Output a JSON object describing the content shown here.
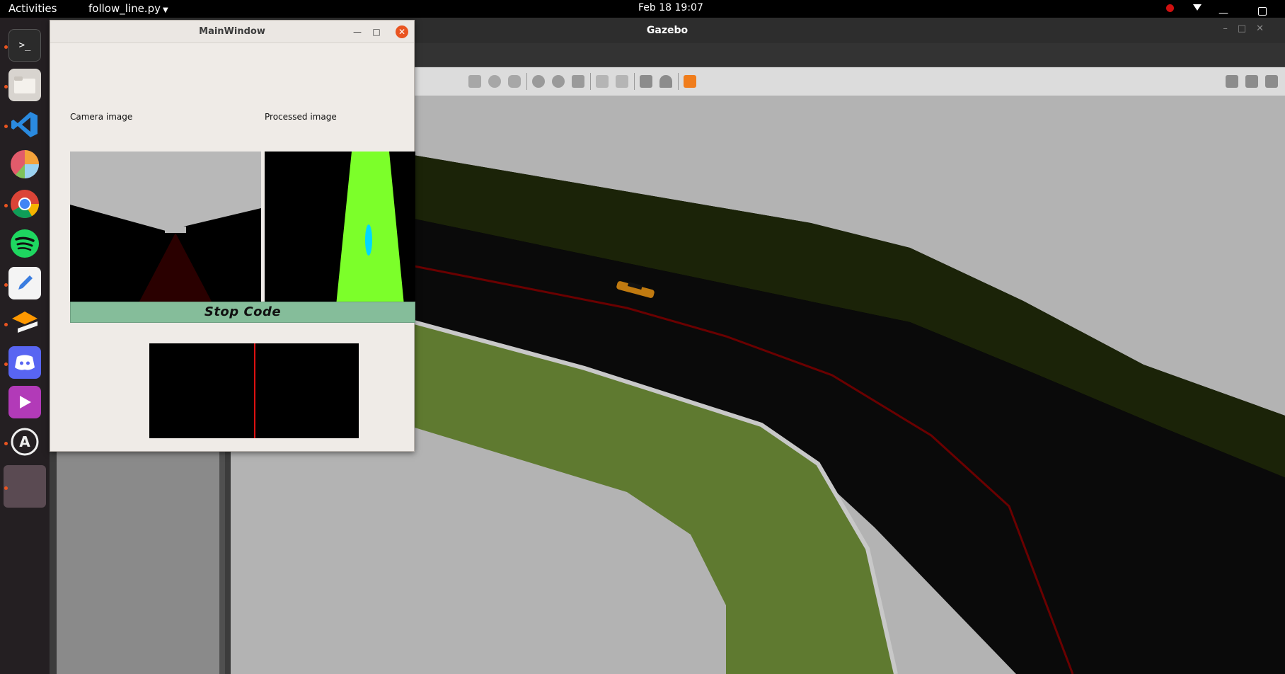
{
  "topbar": {
    "activities": "Activities",
    "app_menu": "follow_line.py",
    "clock": "Feb 18  19:07"
  },
  "dock": {
    "items": [
      {
        "name": "terminal",
        "glyph": ">_"
      },
      {
        "name": "files",
        "glyph": ""
      },
      {
        "name": "vscode",
        "glyph": ""
      },
      {
        "name": "pie-app",
        "glyph": ""
      },
      {
        "name": "chrome",
        "glyph": ""
      },
      {
        "name": "spotify",
        "glyph": ""
      },
      {
        "name": "text-editor",
        "glyph": ""
      },
      {
        "name": "sublime",
        "glyph": ""
      },
      {
        "name": "discord",
        "glyph": ""
      },
      {
        "name": "media-player",
        "glyph": ""
      },
      {
        "name": "software-updater",
        "glyph": "A"
      },
      {
        "name": "active-window",
        "glyph": ""
      }
    ]
  },
  "gazebo": {
    "title": "Gazebo"
  },
  "mainwindow": {
    "title": "MainWindow",
    "camera_label": "Camera image",
    "processed_label": "Processed image",
    "stop_button": "Stop Code"
  },
  "colors": {
    "accent_close": "#e95420",
    "stop_button": "#85bd9a",
    "processed_green": "#7cff2a",
    "centroid_cyan": "#00d8ff",
    "track_red": "#6a0000",
    "grass": "#5f7a30"
  }
}
